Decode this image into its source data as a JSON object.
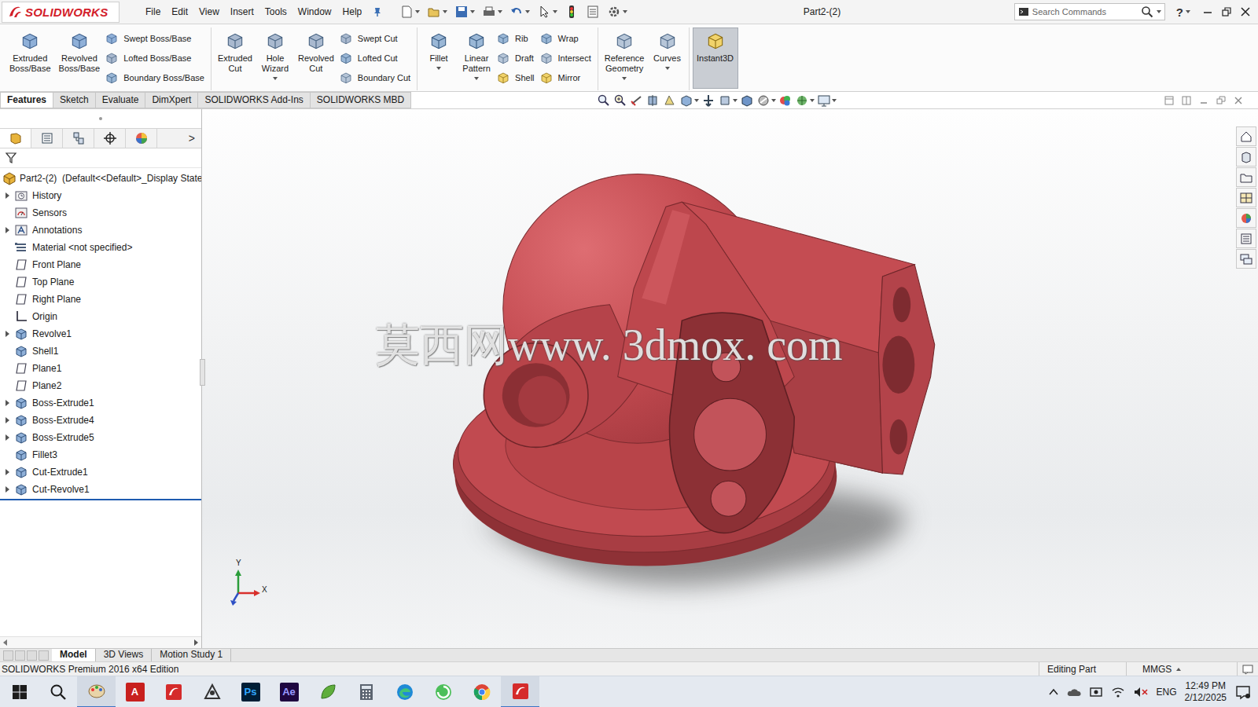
{
  "window": {
    "title": "Part2-(2)",
    "logo": "SOLIDWORKS"
  },
  "menu": [
    "File",
    "Edit",
    "View",
    "Insert",
    "Tools",
    "Window",
    "Help"
  ],
  "search": {
    "placeholder": "Search Commands"
  },
  "help": "?",
  "ribbon": {
    "groups": [
      {
        "items": [
          {
            "kind": "large",
            "lines": [
              "Extruded",
              "Boss/Base"
            ],
            "dropdown": false,
            "selected": false
          },
          {
            "kind": "large",
            "lines": [
              "Revolved",
              "Boss/Base"
            ],
            "dropdown": false,
            "selected": false
          },
          {
            "kind": "stack",
            "items": [
              "Swept Boss/Base",
              "Lofted Boss/Base",
              "Boundary Boss/Base"
            ]
          }
        ]
      },
      {
        "items": [
          {
            "kind": "large",
            "lines": [
              "Extruded",
              "Cut"
            ],
            "dropdown": false,
            "selected": false
          },
          {
            "kind": "large",
            "lines": [
              "Hole",
              "Wizard"
            ],
            "dropdown": true,
            "selected": false
          },
          {
            "kind": "large",
            "lines": [
              "Revolved",
              "Cut"
            ],
            "dropdown": false,
            "selected": false
          },
          {
            "kind": "stack",
            "items": [
              "Swept Cut",
              "Lofted Cut",
              "Boundary Cut"
            ]
          }
        ]
      },
      {
        "items": [
          {
            "kind": "large",
            "lines": [
              "Fillet"
            ],
            "dropdown": true,
            "selected": false
          },
          {
            "kind": "large",
            "lines": [
              "Linear",
              "Pattern"
            ],
            "dropdown": true,
            "selected": false
          },
          {
            "kind": "stack",
            "items": [
              "Rib",
              "Draft",
              "Shell"
            ]
          },
          {
            "kind": "stack",
            "items": [
              "Wrap",
              "Intersect",
              "Mirror"
            ]
          }
        ]
      },
      {
        "items": [
          {
            "kind": "large",
            "lines": [
              "Reference",
              "Geometry"
            ],
            "dropdown": true,
            "selected": false
          },
          {
            "kind": "large",
            "lines": [
              "Curves"
            ],
            "dropdown": true,
            "selected": false
          }
        ]
      },
      {
        "items": [
          {
            "kind": "large",
            "lines": [
              "Instant3D"
            ],
            "dropdown": false,
            "selected": true
          }
        ]
      }
    ]
  },
  "command_tabs": [
    {
      "label": "Features",
      "selected": true
    },
    {
      "label": "Sketch",
      "selected": false
    },
    {
      "label": "Evaluate",
      "selected": false
    },
    {
      "label": "DimXpert",
      "selected": false
    },
    {
      "label": "SOLIDWORKS Add-Ins",
      "selected": false
    },
    {
      "label": "SOLIDWORKS MBD",
      "selected": false
    }
  ],
  "feature_tree": {
    "more": ">",
    "root": "Part2-(2)  (Default<<Default>_Display State",
    "items": [
      {
        "label": "History",
        "expandable": true,
        "kind": "history"
      },
      {
        "label": "Sensors",
        "expandable": false,
        "kind": "sensors"
      },
      {
        "label": "Annotations",
        "expandable": true,
        "kind": "annotations"
      },
      {
        "label": "Material <not specified>",
        "expandable": false,
        "kind": "material"
      },
      {
        "label": "Front Plane",
        "expandable": false,
        "kind": "plane"
      },
      {
        "label": "Top Plane",
        "expandable": false,
        "kind": "plane"
      },
      {
        "label": "Right Plane",
        "expandable": false,
        "kind": "plane"
      },
      {
        "label": "Origin",
        "expandable": false,
        "kind": "origin"
      },
      {
        "label": "Revolve1",
        "expandable": true,
        "kind": "feature"
      },
      {
        "label": "Shell1",
        "expandable": false,
        "kind": "feature"
      },
      {
        "label": "Plane1",
        "expandable": false,
        "kind": "plane"
      },
      {
        "label": "Plane2",
        "expandable": false,
        "kind": "plane"
      },
      {
        "label": "Boss-Extrude1",
        "expandable": true,
        "kind": "feature"
      },
      {
        "label": "Boss-Extrude4",
        "expandable": true,
        "kind": "feature"
      },
      {
        "label": "Boss-Extrude5",
        "expandable": true,
        "kind": "feature"
      },
      {
        "label": "Fillet3",
        "expandable": false,
        "kind": "feature"
      },
      {
        "label": "Cut-Extrude1",
        "expandable": true,
        "kind": "feature"
      },
      {
        "label": "Cut-Revolve1",
        "expandable": true,
        "kind": "feature"
      }
    ]
  },
  "viewport": {
    "watermark": "莫西网www. 3dmox. com",
    "triad": {
      "y": "Y",
      "x": "X"
    }
  },
  "bottom_tabs": [
    {
      "label": "Model",
      "selected": true
    },
    {
      "label": "3D Views",
      "selected": false
    },
    {
      "label": "Motion Study 1",
      "selected": false
    }
  ],
  "status_bar": {
    "edition": "SOLIDWORKS Premium 2016 x64 Edition",
    "mode": "Editing Part",
    "units": "MMGS"
  },
  "taskbar": {
    "items": [
      {
        "kind": "start",
        "active": false
      },
      {
        "kind": "search",
        "active": false
      },
      {
        "kind": "paint",
        "active": true
      },
      {
        "kind": "autocad",
        "label": "A",
        "active": false
      },
      {
        "kind": "solidworks",
        "active": false
      },
      {
        "kind": "network",
        "active": false
      },
      {
        "kind": "photoshop",
        "label": "Ps",
        "active": false
      },
      {
        "kind": "aftereffects",
        "label": "Ae",
        "active": false
      },
      {
        "kind": "leaf",
        "active": false
      },
      {
        "kind": "calculator",
        "active": false
      },
      {
        "kind": "edge",
        "active": false
      },
      {
        "kind": "swirl",
        "active": false
      },
      {
        "kind": "chrome",
        "active": false
      },
      {
        "kind": "solidworks",
        "active": true
      }
    ],
    "tray": {
      "language": "ENG",
      "time": "12:49 PM",
      "date": "2/12/2025"
    }
  }
}
